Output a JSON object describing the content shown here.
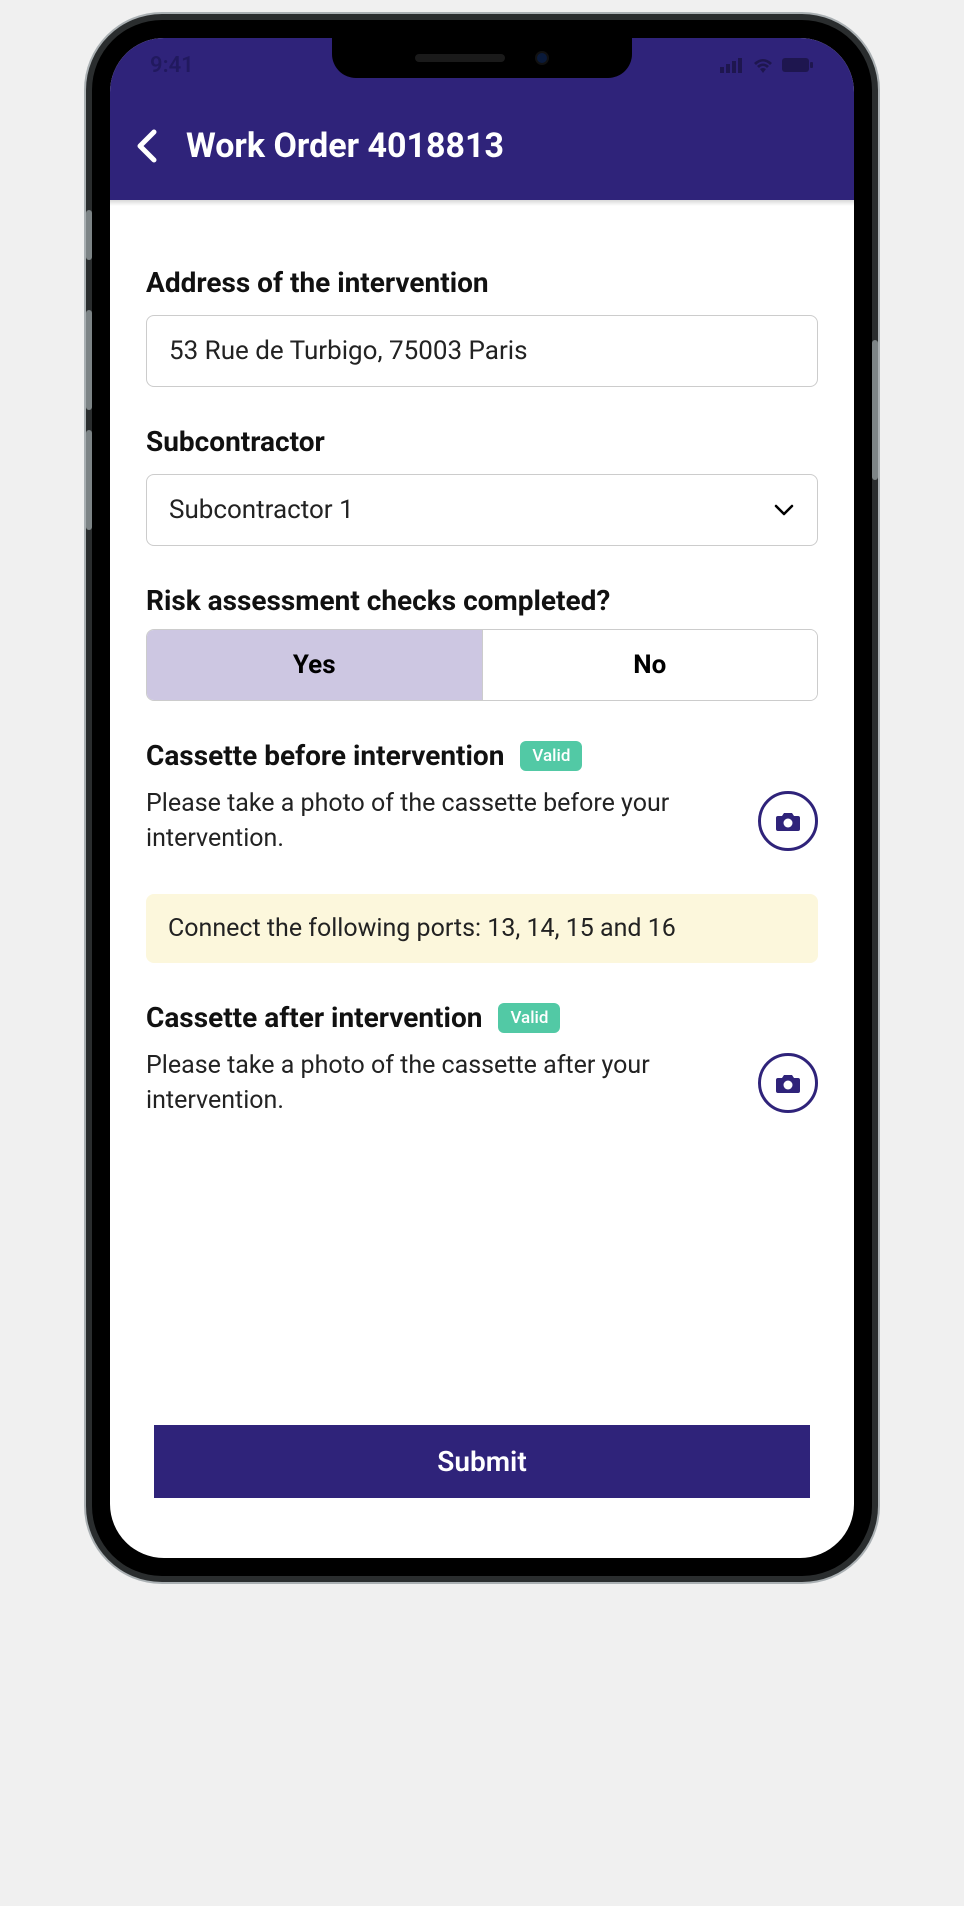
{
  "status": {
    "time": "9:41"
  },
  "header": {
    "title": "Work Order 4018813"
  },
  "fields": {
    "address": {
      "label": "Address of the intervention",
      "value": "53 Rue de Turbigo, 75003 Paris"
    },
    "subcontractor": {
      "label": "Subcontractor",
      "value": "Subcontractor 1"
    },
    "risk": {
      "label": "Risk assessment checks completed?",
      "options": {
        "yes": "Yes",
        "no": "No"
      },
      "selected": "yes"
    },
    "before": {
      "label": "Cassette before intervention",
      "badge": "Valid",
      "desc": "Please take a photo of the cassette before your intervention."
    },
    "note": "Connect the following ports: 13, 14, 15 and 16",
    "after": {
      "label": "Cassette after intervention",
      "badge": "Valid",
      "desc": "Please take a photo of the cassette after your intervention."
    }
  },
  "footer": {
    "submit": "Submit"
  }
}
